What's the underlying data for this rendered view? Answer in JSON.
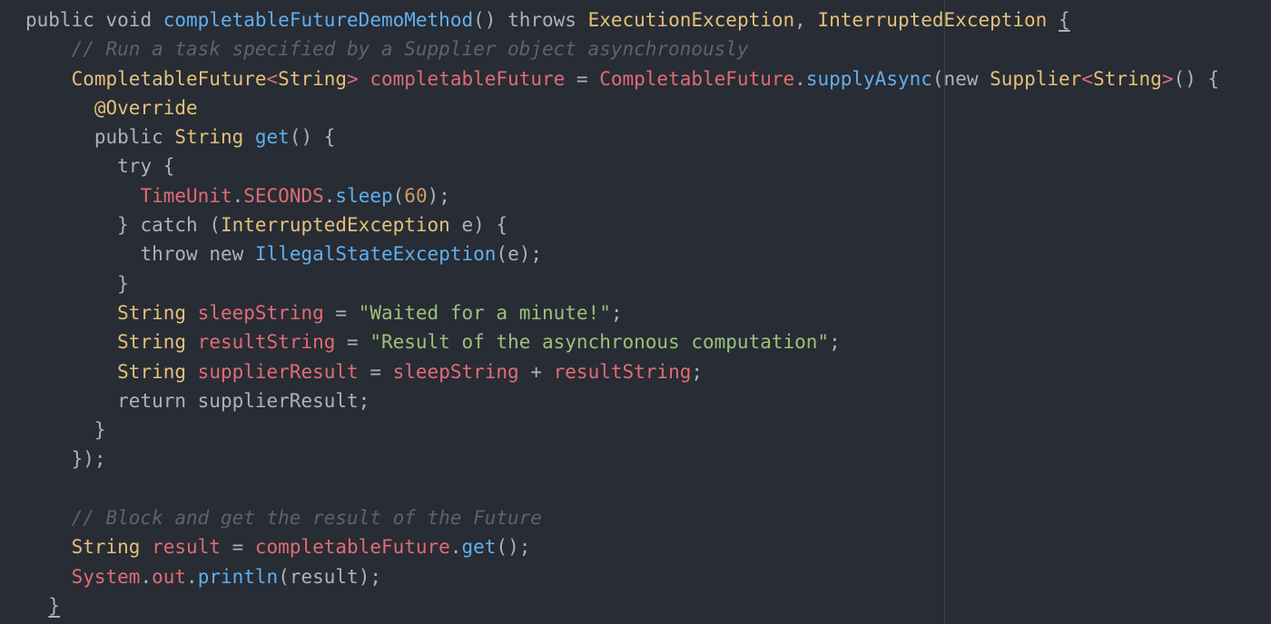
{
  "editor": {
    "theme_colors": {
      "background": "#282c34",
      "keyword": "#c678dd",
      "function": "#61afef",
      "type": "#e5c07b",
      "variable": "#e06c75",
      "string": "#98c379",
      "number": "#d19a66",
      "comment": "#5c6370",
      "plain": "#abb2bf"
    },
    "lines": [
      [
        {
          "t": "public",
          "c": "kw2"
        },
        {
          "t": " ",
          "c": "plain"
        },
        {
          "t": "void",
          "c": "kw2"
        },
        {
          "t": " ",
          "c": "plain"
        },
        {
          "t": "completableFutureDemoMethod",
          "c": "fn"
        },
        {
          "t": "() ",
          "c": "plain"
        },
        {
          "t": "throws",
          "c": "kw2"
        },
        {
          "t": " ",
          "c": "plain"
        },
        {
          "t": "ExecutionException",
          "c": "type"
        },
        {
          "t": ", ",
          "c": "plain"
        },
        {
          "t": "InterruptedException",
          "c": "type"
        },
        {
          "t": " ",
          "c": "plain"
        },
        {
          "t": "{",
          "c": "plain brace-match"
        }
      ],
      [
        {
          "t": "    ",
          "c": "plain"
        },
        {
          "t": "// Run a task specified by a Supplier object asynchronously",
          "c": "cm"
        }
      ],
      [
        {
          "t": "    ",
          "c": "plain"
        },
        {
          "t": "CompletableFuture",
          "c": "type"
        },
        {
          "t": "<",
          "c": "var"
        },
        {
          "t": "String",
          "c": "type"
        },
        {
          "t": ">",
          "c": "var"
        },
        {
          "t": " ",
          "c": "plain"
        },
        {
          "t": "completableFuture",
          "c": "var"
        },
        {
          "t": " = ",
          "c": "plain"
        },
        {
          "t": "CompletableFuture",
          "c": "var"
        },
        {
          "t": ".",
          "c": "plain"
        },
        {
          "t": "supplyAsync",
          "c": "fn"
        },
        {
          "t": "(",
          "c": "plain"
        },
        {
          "t": "new",
          "c": "kw2"
        },
        {
          "t": " ",
          "c": "plain"
        },
        {
          "t": "Supplier",
          "c": "type"
        },
        {
          "t": "<",
          "c": "var"
        },
        {
          "t": "String",
          "c": "type"
        },
        {
          "t": ">",
          "c": "var"
        },
        {
          "t": "() {",
          "c": "plain"
        }
      ],
      [
        {
          "t": "      ",
          "c": "plain"
        },
        {
          "t": "@Override",
          "c": "ann"
        }
      ],
      [
        {
          "t": "      ",
          "c": "plain"
        },
        {
          "t": "public",
          "c": "kw2"
        },
        {
          "t": " ",
          "c": "plain"
        },
        {
          "t": "String",
          "c": "type"
        },
        {
          "t": " ",
          "c": "plain"
        },
        {
          "t": "get",
          "c": "fn"
        },
        {
          "t": "() {",
          "c": "plain"
        }
      ],
      [
        {
          "t": "        ",
          "c": "plain"
        },
        {
          "t": "try",
          "c": "kw2"
        },
        {
          "t": " {",
          "c": "plain"
        }
      ],
      [
        {
          "t": "          ",
          "c": "plain"
        },
        {
          "t": "TimeUnit",
          "c": "var"
        },
        {
          "t": ".",
          "c": "plain"
        },
        {
          "t": "SECONDS",
          "c": "var"
        },
        {
          "t": ".",
          "c": "plain"
        },
        {
          "t": "sleep",
          "c": "fn"
        },
        {
          "t": "(",
          "c": "plain"
        },
        {
          "t": "60",
          "c": "num"
        },
        {
          "t": ");",
          "c": "plain"
        }
      ],
      [
        {
          "t": "        ",
          "c": "plain"
        },
        {
          "t": "} ",
          "c": "plain"
        },
        {
          "t": "catch",
          "c": "kw2"
        },
        {
          "t": " (",
          "c": "plain"
        },
        {
          "t": "InterruptedException",
          "c": "type"
        },
        {
          "t": " e) {",
          "c": "plain"
        }
      ],
      [
        {
          "t": "          ",
          "c": "plain"
        },
        {
          "t": "throw",
          "c": "kw2"
        },
        {
          "t": " ",
          "c": "plain"
        },
        {
          "t": "new",
          "c": "kw2"
        },
        {
          "t": " ",
          "c": "plain"
        },
        {
          "t": "IllegalStateException",
          "c": "fn"
        },
        {
          "t": "(e);",
          "c": "plain"
        }
      ],
      [
        {
          "t": "        ",
          "c": "plain"
        },
        {
          "t": "}",
          "c": "plain"
        }
      ],
      [
        {
          "t": "        ",
          "c": "plain"
        },
        {
          "t": "String",
          "c": "type"
        },
        {
          "t": " ",
          "c": "plain"
        },
        {
          "t": "sleepString",
          "c": "var"
        },
        {
          "t": " = ",
          "c": "plain"
        },
        {
          "t": "\"Waited for a minute!\"",
          "c": "str"
        },
        {
          "t": ";",
          "c": "plain"
        }
      ],
      [
        {
          "t": "        ",
          "c": "plain"
        },
        {
          "t": "String",
          "c": "type"
        },
        {
          "t": " ",
          "c": "plain"
        },
        {
          "t": "resultString",
          "c": "var"
        },
        {
          "t": " = ",
          "c": "plain"
        },
        {
          "t": "\"Result of the asynchronous computation\"",
          "c": "str"
        },
        {
          "t": ";",
          "c": "plain"
        }
      ],
      [
        {
          "t": "        ",
          "c": "plain"
        },
        {
          "t": "String",
          "c": "type"
        },
        {
          "t": " ",
          "c": "plain"
        },
        {
          "t": "supplierResult",
          "c": "var"
        },
        {
          "t": " = ",
          "c": "plain"
        },
        {
          "t": "sleepString",
          "c": "var"
        },
        {
          "t": " + ",
          "c": "plain"
        },
        {
          "t": "resultString",
          "c": "var"
        },
        {
          "t": ";",
          "c": "plain"
        }
      ],
      [
        {
          "t": "        ",
          "c": "plain"
        },
        {
          "t": "return",
          "c": "kw2"
        },
        {
          "t": " supplierResult;",
          "c": "plain"
        }
      ],
      [
        {
          "t": "      ",
          "c": "plain"
        },
        {
          "t": "}",
          "c": "plain"
        }
      ],
      [
        {
          "t": "    ",
          "c": "plain"
        },
        {
          "t": "});",
          "c": "plain"
        }
      ],
      [
        {
          "t": "",
          "c": "plain"
        }
      ],
      [
        {
          "t": "    ",
          "c": "plain"
        },
        {
          "t": "// Block and get the result of the Future",
          "c": "cm"
        }
      ],
      [
        {
          "t": "    ",
          "c": "plain"
        },
        {
          "t": "String",
          "c": "type"
        },
        {
          "t": " ",
          "c": "plain"
        },
        {
          "t": "result",
          "c": "var"
        },
        {
          "t": " = ",
          "c": "plain"
        },
        {
          "t": "completableFuture",
          "c": "var"
        },
        {
          "t": ".",
          "c": "plain"
        },
        {
          "t": "get",
          "c": "fn"
        },
        {
          "t": "();",
          "c": "plain"
        }
      ],
      [
        {
          "t": "    ",
          "c": "plain"
        },
        {
          "t": "System",
          "c": "var"
        },
        {
          "t": ".",
          "c": "plain"
        },
        {
          "t": "out",
          "c": "var"
        },
        {
          "t": ".",
          "c": "plain"
        },
        {
          "t": "println",
          "c": "fn"
        },
        {
          "t": "(result);",
          "c": "plain"
        }
      ],
      [
        {
          "t": "  ",
          "c": "plain"
        },
        {
          "t": "}",
          "c": "plain brace-match"
        }
      ]
    ]
  }
}
